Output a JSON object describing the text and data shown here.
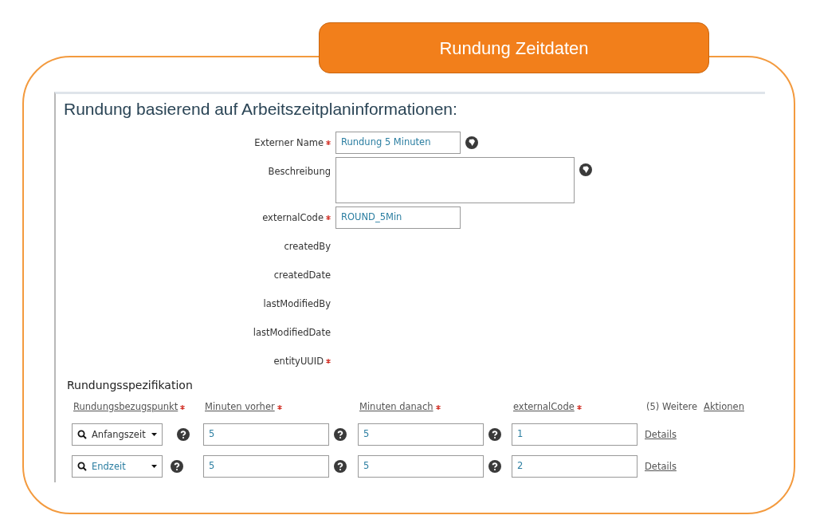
{
  "banner": {
    "title": "Rundung Zeitdaten"
  },
  "heading": "Rundung basierend auf Arbeitszeitplaninformationen:",
  "fields": [
    {
      "label": "Externer Name",
      "required": true,
      "kind": "input",
      "value": "Rundung 5 Minuten",
      "translatable": true
    },
    {
      "label": "Beschreibung",
      "required": false,
      "kind": "textarea",
      "translatable": true
    },
    {
      "label": "externalCode",
      "required": true,
      "kind": "input",
      "value": "ROUND_5Min",
      "translatable": false
    },
    {
      "label": "createdBy",
      "required": false,
      "kind": "readonly",
      "translatable": false
    },
    {
      "label": "createdDate",
      "required": false,
      "kind": "readonly",
      "translatable": false
    },
    {
      "label": "lastModifiedBy",
      "required": false,
      "kind": "readonly",
      "translatable": false
    },
    {
      "label": "lastModifiedDate",
      "required": false,
      "kind": "readonly",
      "translatable": false
    },
    {
      "label": "entityUUID",
      "required": true,
      "kind": "readonly",
      "translatable": false
    }
  ],
  "spec": {
    "title": "Rundungsspezifikation",
    "columns": [
      {
        "label": "Rundungsbezugspunkt",
        "required": true
      },
      {
        "label": "Minuten vorher",
        "required": true
      },
      {
        "label": "Minuten danach",
        "required": true
      },
      {
        "label": "externalCode",
        "required": true
      }
    ],
    "more": "(5) Weitere",
    "actions": "Aktionen",
    "rows": [
      {
        "reference": "Anfangszeit",
        "highlighted": false,
        "before": "5",
        "after": "5",
        "code": "1",
        "action": "Details"
      },
      {
        "reference": "Endzeit",
        "highlighted": true,
        "before": "5",
        "after": "5",
        "code": "2",
        "action": "Details"
      }
    ]
  }
}
